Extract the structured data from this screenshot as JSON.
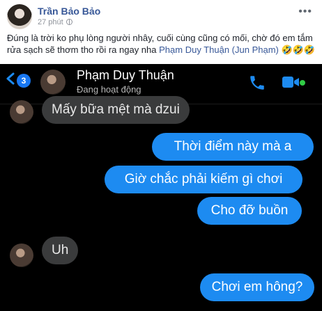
{
  "post": {
    "author": "Trần Bảo Bảo",
    "time": "27 phút",
    "more_label": "•••",
    "caption_text": "Đúng là trời ko phụ lòng người nhây, cuối cùng cũng có mối, chờ đó em tắm rửa sạch sẽ thơm tho rồi ra ngay nha ",
    "caption_mention": "Phạm Duy Thuận (Jun Phạm)",
    "caption_emoji": " 🤣🤣🤣"
  },
  "chat": {
    "unread_count": "3",
    "contact_name": "Phạm Duy Thuận",
    "contact_status": "Đang hoạt động",
    "accent_color": "#1d8bf1",
    "messages": [
      {
        "from": "contact",
        "text": "Mấy bữa mệt mà dzui"
      },
      {
        "from": "me",
        "text": "Thời điểm này mà a"
      },
      {
        "from": "me",
        "text": "Giờ chắc phải kiếm gì chơi"
      },
      {
        "from": "me",
        "text": "Cho đỡ buồn"
      },
      {
        "from": "contact",
        "text": "Uh"
      },
      {
        "from": "me",
        "text": "Chơi em hông?"
      }
    ]
  }
}
